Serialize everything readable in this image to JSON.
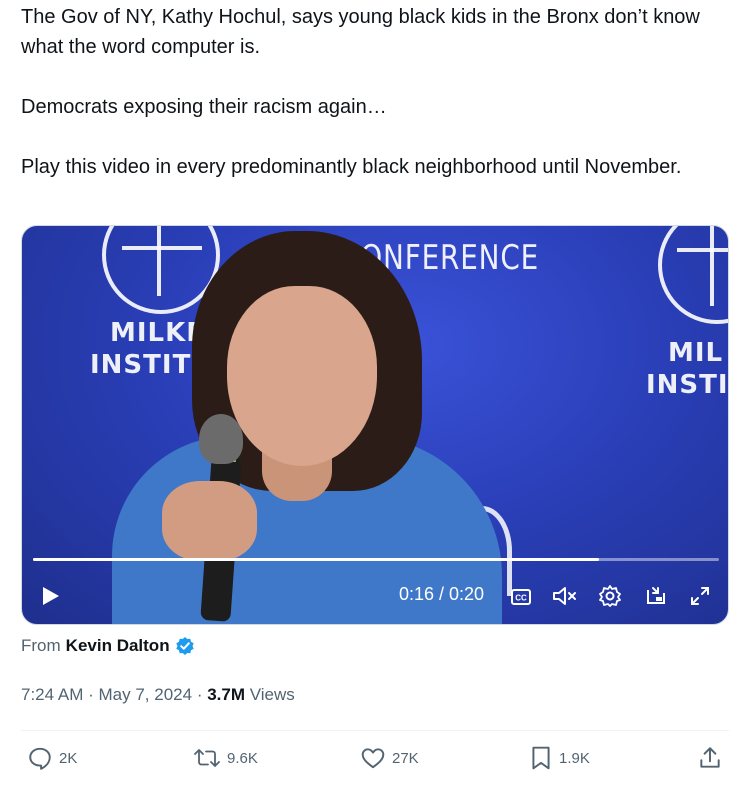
{
  "tweet": {
    "paragraphs": [
      "The Gov of NY, Kathy Hochul, says young black kids in the Bronx don’t know what the word computer is.",
      "Democrats exposing their racism again…",
      "Play this video in every predominantly black neighborhood until November."
    ]
  },
  "video": {
    "backdrop_text": {
      "conference": "CONFERENCE",
      "milken_left_1": "MILKE",
      "milken_left_2": "INSTITU",
      "milken_right_1": "MIL",
      "milken_right_2": "INSTI"
    },
    "time_display": "0:16 / 0:20",
    "progress_fraction": 0.825,
    "icons": [
      "play-icon",
      "captions-icon",
      "mute-icon",
      "settings-icon",
      "pip-icon",
      "fullscreen-icon"
    ]
  },
  "attribution": {
    "prefix": "From",
    "name": "Kevin Dalton"
  },
  "meta": {
    "time": "7:24 AM",
    "date": "May 7, 2024",
    "views_count": "3.7M",
    "views_label": "Views",
    "sep": "·"
  },
  "actions": {
    "replies": "2K",
    "reposts": "9.6K",
    "likes": "27K",
    "bookmarks": "1.9K"
  },
  "colors": {
    "text_primary": "#0f1419",
    "text_secondary": "#536471",
    "verified_blue": "#1d9bf0",
    "video_blue": "#2a3fb8"
  }
}
